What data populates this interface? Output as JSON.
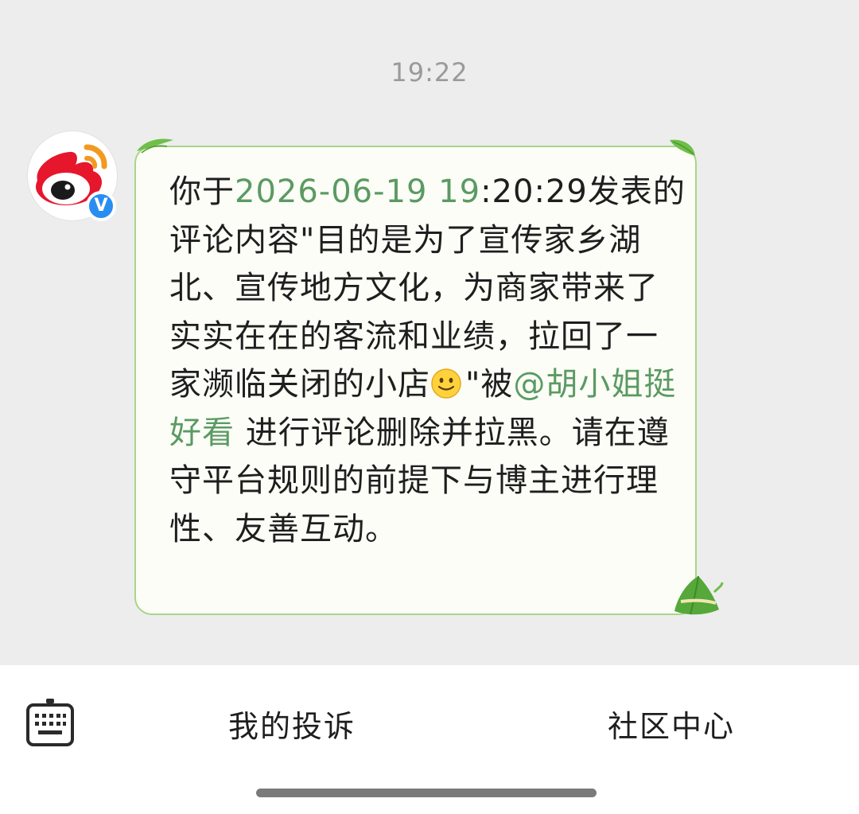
{
  "conversation": {
    "timestamp": "19:22"
  },
  "sender": {
    "avatar_icon": "weibo-logo-icon",
    "verified_icon": "verified-v-icon",
    "verified_text": "V",
    "brand_color": "#e6162d",
    "verified_color": "#2a8ef0"
  },
  "message": {
    "part1": "你于",
    "date_highlight": "2026-06-19 19",
    "part2": ":20:29发表的评论内容\"目的是为了宣传家乡湖北、宣传地方文化，为商家带来了实实在在的客流和业绩，拉回了一家濒临关闭的小店",
    "emoji_icon": "smile-emoji-icon",
    "part3": "\"被",
    "mention": "@胡小姐挺好看",
    "part4": " 进行评论删除并拉黑。请在遵守平台规则的前提下与博主进行理性、友善互动。",
    "highlight_color": "#5b9a63",
    "bubble_border_color": "#a9d58a"
  },
  "bottom_bar": {
    "keyboard_icon": "keyboard-icon",
    "complaint_label": "我的投诉",
    "community_label": "社区中心"
  }
}
